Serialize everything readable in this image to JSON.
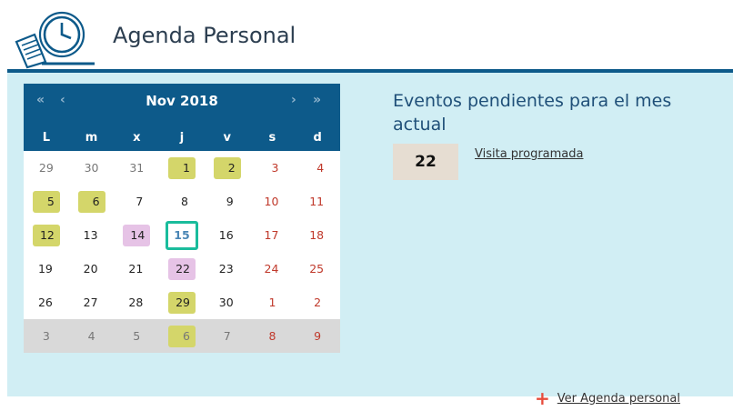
{
  "header": {
    "title": "Agenda Personal"
  },
  "calendar": {
    "month_label": "Nov 2018",
    "nav": {
      "prev_year": "«",
      "prev_month": "‹",
      "next_month": "›",
      "next_year": "»"
    },
    "weekdays": [
      "L",
      "m",
      "x",
      "j",
      "v",
      "s",
      "d"
    ],
    "weeks": [
      [
        {
          "d": "29",
          "t": "other"
        },
        {
          "d": "30",
          "t": "other"
        },
        {
          "d": "31",
          "t": "other"
        },
        {
          "d": "1",
          "t": "ev"
        },
        {
          "d": "2",
          "t": "ev"
        },
        {
          "d": "3",
          "t": "we"
        },
        {
          "d": "4",
          "t": "we"
        }
      ],
      [
        {
          "d": "5",
          "t": "ev"
        },
        {
          "d": "6",
          "t": "ev"
        },
        {
          "d": "7"
        },
        {
          "d": "8"
        },
        {
          "d": "9"
        },
        {
          "d": "10",
          "t": "we"
        },
        {
          "d": "11",
          "t": "we"
        }
      ],
      [
        {
          "d": "12",
          "t": "ev"
        },
        {
          "d": "13"
        },
        {
          "d": "14",
          "t": "ev2"
        },
        {
          "d": "15",
          "t": "today"
        },
        {
          "d": "16"
        },
        {
          "d": "17",
          "t": "we"
        },
        {
          "d": "18",
          "t": "we"
        }
      ],
      [
        {
          "d": "19"
        },
        {
          "d": "20"
        },
        {
          "d": "21"
        },
        {
          "d": "22",
          "t": "ev2"
        },
        {
          "d": "23"
        },
        {
          "d": "24",
          "t": "we"
        },
        {
          "d": "25",
          "t": "we"
        }
      ],
      [
        {
          "d": "26"
        },
        {
          "d": "27"
        },
        {
          "d": "28"
        },
        {
          "d": "29",
          "t": "ev"
        },
        {
          "d": "30"
        },
        {
          "d": "1",
          "t": "wenext"
        },
        {
          "d": "2",
          "t": "wenext"
        }
      ],
      [
        {
          "d": "3",
          "t": "next"
        },
        {
          "d": "4",
          "t": "next"
        },
        {
          "d": "5",
          "t": "next"
        },
        {
          "d": "6",
          "t": "evnext"
        },
        {
          "d": "7",
          "t": "next"
        },
        {
          "d": "8",
          "t": "wenext"
        },
        {
          "d": "9",
          "t": "wenext"
        }
      ]
    ]
  },
  "events": {
    "heading": "Eventos pendientes para el mes actual",
    "count": "22",
    "link_label": "Visita programada"
  },
  "footer": {
    "link_label": "Ver Agenda personal"
  },
  "colors": {
    "primary": "#0d5a8a",
    "panel": "#d1eef4",
    "event": "#d4d66a",
    "event_alt": "#e6c3e6",
    "today": "#1abc9c"
  }
}
